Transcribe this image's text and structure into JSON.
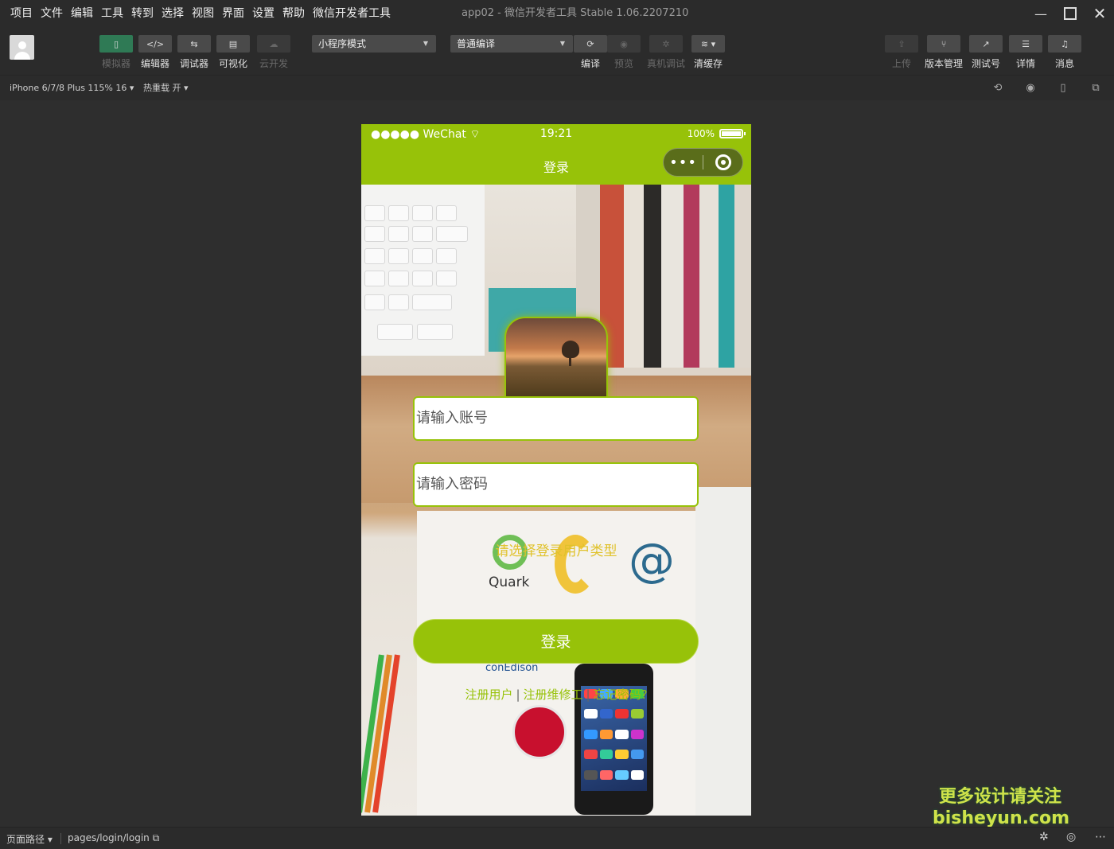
{
  "menu": [
    "项目",
    "文件",
    "编辑",
    "工具",
    "转到",
    "选择",
    "视图",
    "界面",
    "设置",
    "帮助",
    "微信开发者工具"
  ],
  "window_title": "app02 - 微信开发者工具 Stable 1.06.2207210",
  "toolbar": {
    "simulator": "模拟器",
    "editor": "编辑器",
    "debugger": "调试器",
    "visual": "可视化",
    "cloud": "云开发",
    "mode_select": "小程序模式",
    "compile_select": "普通编译",
    "compile": "编译",
    "preview": "预览",
    "remote_debug": "真机调试",
    "clear_cache": "清缓存",
    "upload": "上传",
    "version": "版本管理",
    "test": "测试号",
    "details": "详情",
    "messages": "消息"
  },
  "subbar": {
    "device": "iPhone 6/7/8 Plus 115% 16 ▾",
    "hot_reload": "热重载 开 ▾"
  },
  "phone": {
    "carrier": "●●●●● WeChat",
    "time": "19:21",
    "battery": "100%",
    "nav_title": "登录",
    "username_placeholder": "请输入账号",
    "password_placeholder": "请输入密码",
    "user_type_label": "请选择登录用户类型",
    "login_button": "登录",
    "link_register_user": "注册用户",
    "link_register_repair": "注册维修工",
    "link_forgot": "忘记密码?",
    "brands": {
      "quark": "Quark",
      "conedison": "conEdison"
    }
  },
  "watermark": {
    "line1": "更多设计请关注",
    "line2": "bisheyun.com"
  },
  "bottom": {
    "page_path_label": "页面路径 ▾",
    "page_path": "pages/login/login"
  }
}
